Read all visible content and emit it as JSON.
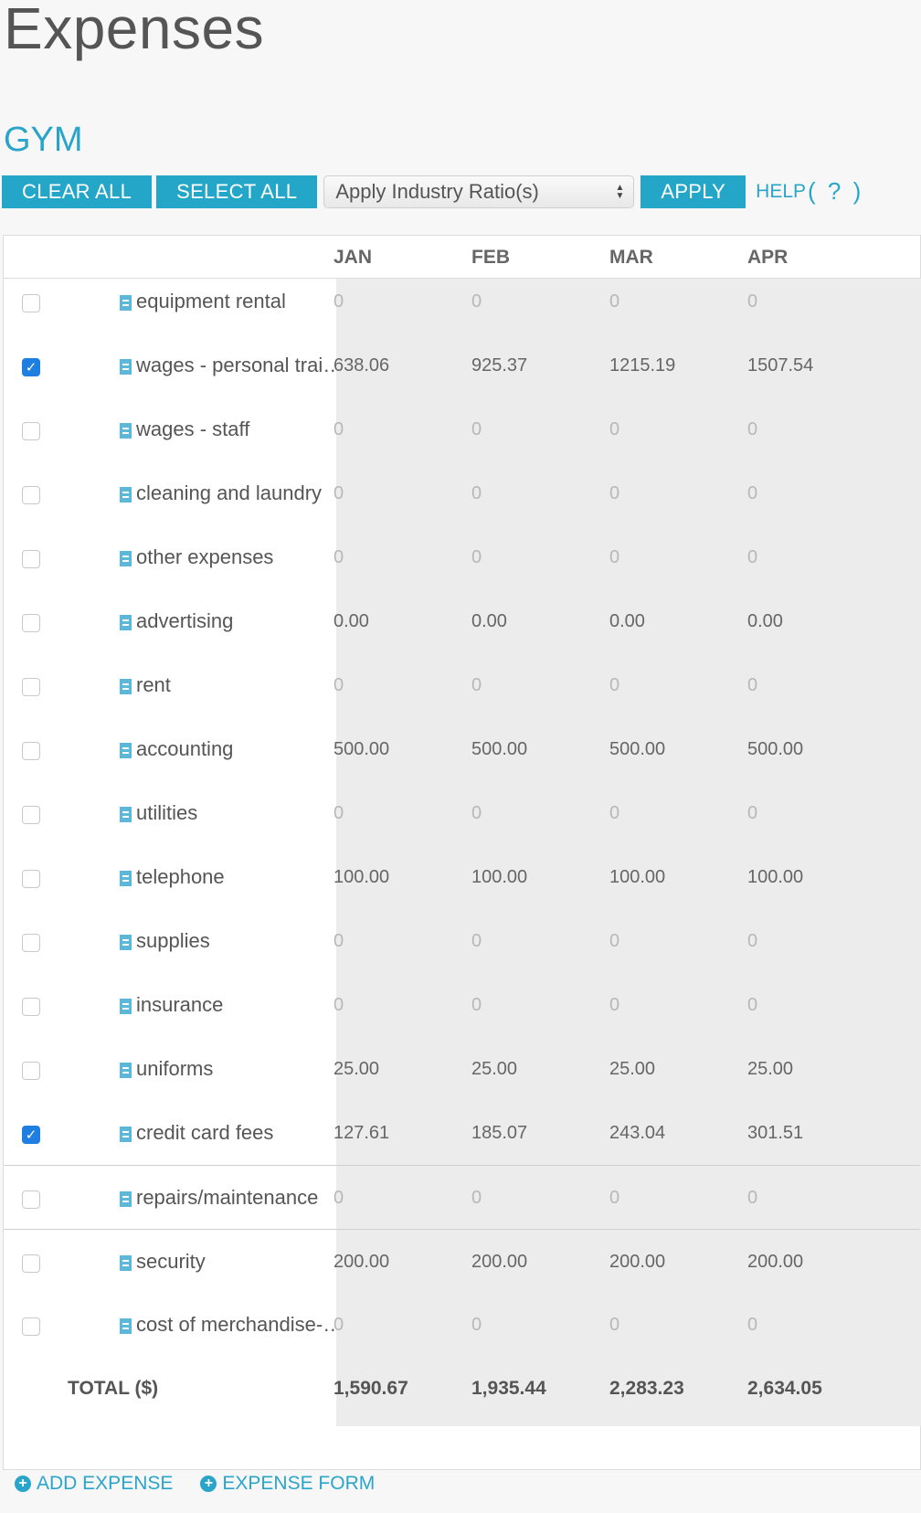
{
  "page": {
    "title": "Expenses"
  },
  "section": {
    "title": "GYM"
  },
  "toolbar": {
    "clear_all": "CLEAR ALL",
    "select_all": "SELECT ALL",
    "ratio_select": "Apply Industry Ratio(s)",
    "apply": "APPLY",
    "help_label": "HELP",
    "help_q": "( ? )"
  },
  "table": {
    "columns": [
      "JAN",
      "FEB",
      "MAR",
      "APR"
    ],
    "rows": [
      {
        "name": "equipment rental",
        "checked": false,
        "values": [
          "0",
          "0",
          "0",
          "0"
        ]
      },
      {
        "name": "wages - personal trai…",
        "checked": true,
        "values": [
          "638.06",
          "925.37",
          "1215.19",
          "1507.54"
        ]
      },
      {
        "name": "wages - staff",
        "checked": false,
        "values": [
          "0",
          "0",
          "0",
          "0"
        ]
      },
      {
        "name": "cleaning and laundry",
        "checked": false,
        "values": [
          "0",
          "0",
          "0",
          "0"
        ]
      },
      {
        "name": "other expenses",
        "checked": false,
        "values": [
          "0",
          "0",
          "0",
          "0"
        ]
      },
      {
        "name": "advertising",
        "checked": false,
        "values": [
          "0.00",
          "0.00",
          "0.00",
          "0.00"
        ]
      },
      {
        "name": "rent",
        "checked": false,
        "values": [
          "0",
          "0",
          "0",
          "0"
        ]
      },
      {
        "name": "accounting",
        "checked": false,
        "values": [
          "500.00",
          "500.00",
          "500.00",
          "500.00"
        ]
      },
      {
        "name": "utilities",
        "checked": false,
        "values": [
          "0",
          "0",
          "0",
          "0"
        ]
      },
      {
        "name": "telephone",
        "checked": false,
        "values": [
          "100.00",
          "100.00",
          "100.00",
          "100.00"
        ]
      },
      {
        "name": "supplies",
        "checked": false,
        "values": [
          "0",
          "0",
          "0",
          "0"
        ]
      },
      {
        "name": "insurance",
        "checked": false,
        "values": [
          "0",
          "0",
          "0",
          "0"
        ]
      },
      {
        "name": "uniforms",
        "checked": false,
        "values": [
          "25.00",
          "25.00",
          "25.00",
          "25.00"
        ]
      },
      {
        "name": "credit card fees",
        "checked": true,
        "values": [
          "127.61",
          "185.07",
          "243.04",
          "301.51"
        ]
      },
      {
        "name": "repairs/maintenance",
        "checked": false,
        "values": [
          "0",
          "0",
          "0",
          "0"
        ]
      },
      {
        "name": "security",
        "checked": false,
        "values": [
          "200.00",
          "200.00",
          "200.00",
          "200.00"
        ]
      },
      {
        "name": "cost of merchandise-…",
        "checked": false,
        "values": [
          "0",
          "0",
          "0",
          "0"
        ]
      }
    ],
    "total_label": "TOTAL ($)",
    "totals": [
      "1,590.67",
      "1,935.44",
      "2,283.23",
      "2,634.05"
    ]
  },
  "footer": {
    "add_expense": "ADD EXPENSE",
    "expense_form": "EXPENSE FORM"
  }
}
